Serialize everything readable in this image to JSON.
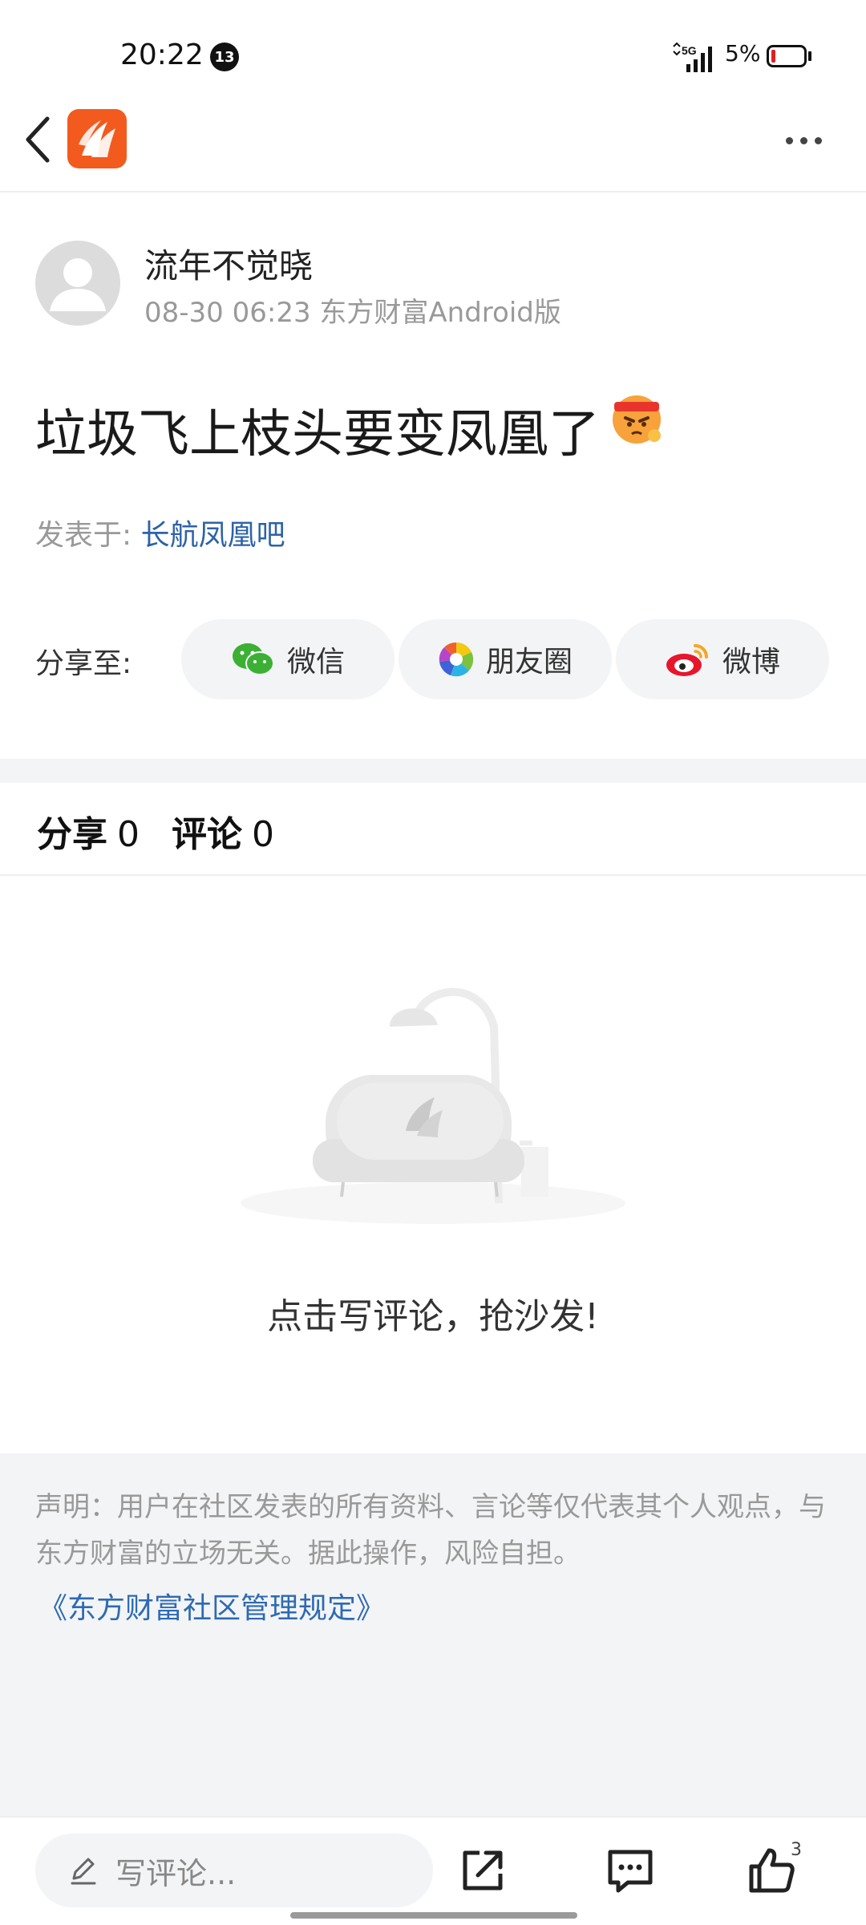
{
  "status_bar": {
    "time": "20:22",
    "notification_count": "13",
    "network": "5G",
    "battery_percent": "5%"
  },
  "post": {
    "author_name": "流年不觉晓",
    "meta": "08-30 06:23 东方财富Android版",
    "title": "垃圾飞上枝头要变凤凰了",
    "title_emoji": "angry-headband-emoji",
    "posted_in_label": "发表于: ",
    "forum_name": "长航凤凰吧"
  },
  "share": {
    "label": "分享至:",
    "buttons": [
      {
        "label": "微信",
        "icon": "wechat-icon"
      },
      {
        "label": "朋友圈",
        "icon": "moments-icon"
      },
      {
        "label": "微博",
        "icon": "weibo-icon"
      }
    ]
  },
  "counts": {
    "share_label": "分享",
    "share_count": "0",
    "comment_label": "评论",
    "comment_count": "0"
  },
  "empty_state": {
    "text": "点击写评论，抢沙发!"
  },
  "disclaimer": {
    "text": "声明：用户在社区发表的所有资料、言论等仅代表其个人观点，与东方财富的立场无关。据此操作，风险自担。",
    "link": "《东方财富社区管理规定》"
  },
  "bottom_bar": {
    "comment_placeholder": "写评论...",
    "like_count": "3"
  },
  "colors": {
    "brand": "#f35a1e",
    "link": "#2d63a7",
    "background_gray": "#f3f4f6"
  }
}
